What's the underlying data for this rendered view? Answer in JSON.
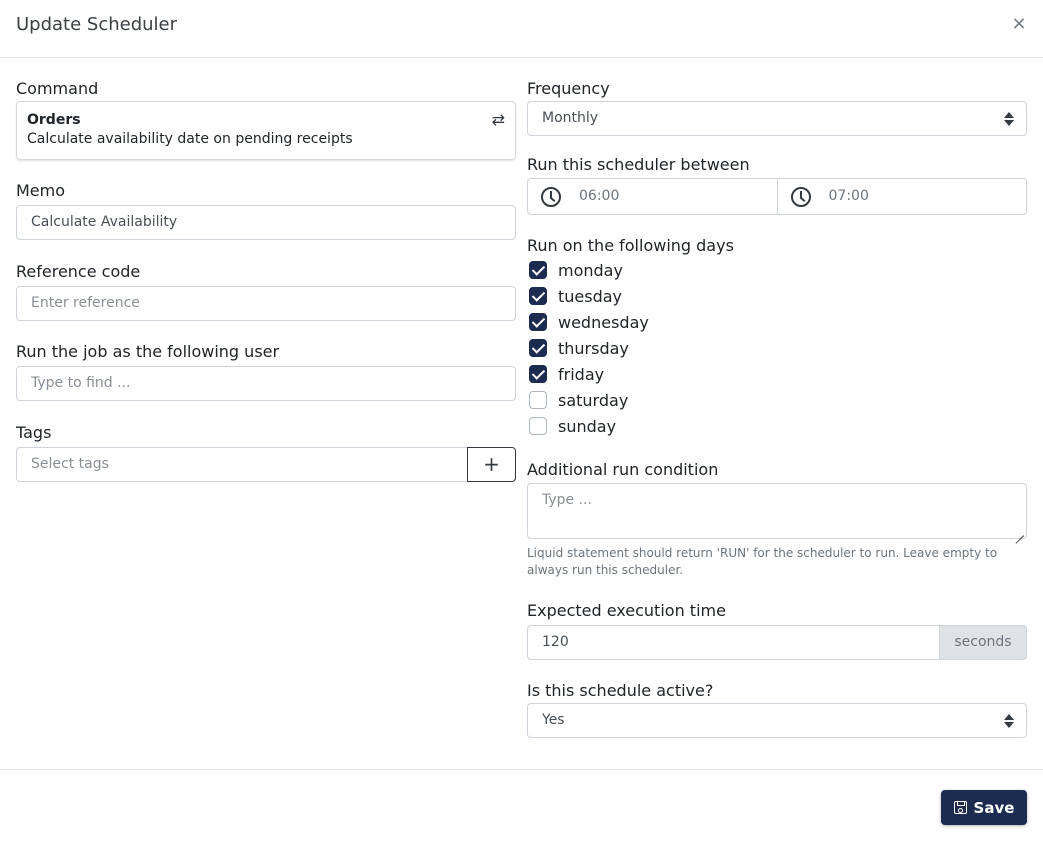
{
  "modal": {
    "title": "Update Scheduler",
    "close_glyph": "×"
  },
  "command": {
    "label": "Command",
    "title": "Orders",
    "description": "Calculate availability date on pending receipts",
    "swap_icon": "swap-arrows-icon",
    "swap_glyph": "⇄"
  },
  "memo": {
    "label": "Memo",
    "value": "Calculate Availability"
  },
  "reference": {
    "label": "Reference code",
    "placeholder": "Enter reference"
  },
  "run_as_user": {
    "label": "Run the job as the following user",
    "placeholder": "Type to find ..."
  },
  "tags": {
    "label": "Tags",
    "placeholder": "Select tags",
    "add_glyph": "+"
  },
  "frequency": {
    "label": "Frequency",
    "selected": "Monthly"
  },
  "time_window": {
    "label": "Run this scheduler between",
    "start": "06:00",
    "end": "07:00"
  },
  "days": {
    "label": "Run on the following days",
    "items": [
      {
        "label": "monday",
        "checked": true
      },
      {
        "label": "tuesday",
        "checked": true
      },
      {
        "label": "wednesday",
        "checked": true
      },
      {
        "label": "thursday",
        "checked": true
      },
      {
        "label": "friday",
        "checked": true
      },
      {
        "label": "saturday",
        "checked": false
      },
      {
        "label": "sunday",
        "checked": false
      }
    ]
  },
  "condition": {
    "label": "Additional run condition",
    "placeholder": "Type ...",
    "help": "Liquid statement should return 'RUN' for the scheduler to run. Leave empty to always run this scheduler."
  },
  "execution_time": {
    "label": "Expected execution time",
    "value": "120",
    "unit": "seconds"
  },
  "active": {
    "label": "Is this schedule active?",
    "selected": "Yes"
  },
  "footer": {
    "save_label": "Save"
  },
  "colors": {
    "primary": "#1c2b50",
    "border": "#ced4da",
    "addon_bg": "#e0e3e6"
  }
}
